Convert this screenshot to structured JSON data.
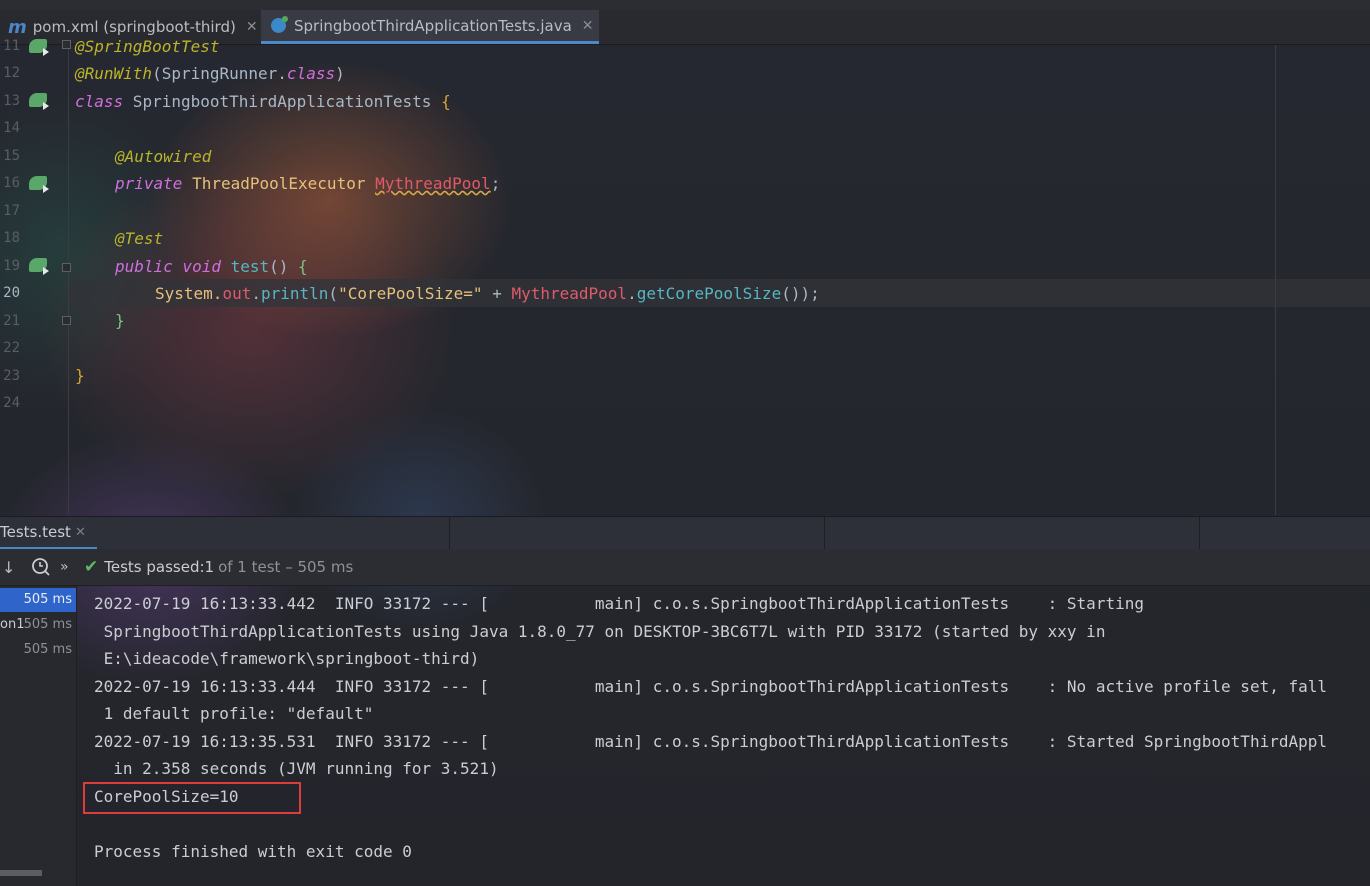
{
  "tabs": [
    {
      "label": "pom.xml (springboot-third)",
      "icon": "maven-icon"
    },
    {
      "label": "SpringbootThirdApplicationTests.java",
      "icon": "java-class-icon",
      "active": true
    }
  ],
  "editor": {
    "line_numbers": [
      "11",
      "12",
      "13",
      "14",
      "15",
      "16",
      "17",
      "18",
      "19",
      "20",
      "21",
      "22",
      "23",
      "24"
    ],
    "current_line": "20",
    "code": {
      "l11": "@SpringBootTest",
      "l12_ann": "@RunWith",
      "l12_p1": "(SpringRunner.",
      "l12_kw": "class",
      "l12_p2": ")",
      "l13_kw": "class",
      "l13_name": " SpringbootThirdApplicationTests ",
      "l13_brace": "{",
      "l15": "@Autowired",
      "l16_kw": "private",
      "l16_type": " ThreadPoolExecutor ",
      "l16_field": "MythreadPool",
      "l16_semi": ";",
      "l18": "@Test",
      "l19_kw1": "public",
      "l19_kw2": " void",
      "l19_method": " test",
      "l19_paren": "() ",
      "l19_brace": "{",
      "l20_sys": "System.",
      "l20_out": "out",
      "l20_dot": ".",
      "l20_println": "println",
      "l20_open": "(",
      "l20_str": "\"CorePoolSize=\"",
      "l20_plus": " + ",
      "l20_field": "MythreadPool",
      "l20_dot2": ".",
      "l20_call": "getCorePoolSize",
      "l20_end": "());",
      "l21": "}",
      "l23": "}"
    }
  },
  "run_panel": {
    "tab_label": "Tests.test",
    "status": {
      "prefix": "Tests passed: ",
      "count": "1",
      "suffix": "of 1 test – 505 ms"
    },
    "tree": [
      {
        "name": "",
        "time": "505 ms",
        "selected": true
      },
      {
        "name": "on1",
        "time": "505 ms"
      },
      {
        "name": "",
        "time": "505 ms"
      }
    ],
    "console": [
      "2022-07-19 16:13:33.442  INFO 33172 --- [           main] c.o.s.SpringbootThirdApplicationTests    : Starting",
      " SpringbootThirdApplicationTests using Java 1.8.0_77 on DESKTOP-3BC6T7L with PID 33172 (started by xxy in",
      " E:\\ideacode\\framework\\springboot-third)",
      "2022-07-19 16:13:33.444  INFO 33172 --- [           main] c.o.s.SpringbootThirdApplicationTests    : No active profile set, fall",
      " 1 default profile: \"default\"",
      "2022-07-19 16:13:35.531  INFO 33172 --- [           main] c.o.s.SpringbootThirdApplicationTests    : Started SpringbootThirdAppl",
      "  in 2.358 seconds (JVM running for 3.521)",
      "CorePoolSize=10",
      "",
      "Process finished with exit code 0"
    ]
  },
  "colors": {
    "accent": "#4a88c7",
    "pass": "#5fb865",
    "highlight_box": "#e03b3b"
  }
}
